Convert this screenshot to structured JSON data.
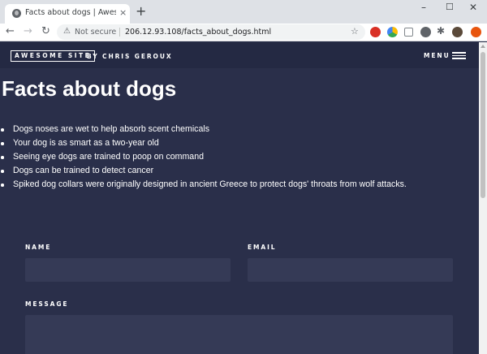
{
  "browser": {
    "tab_title": "Facts about dogs | Awesome Site",
    "tab_close": "×",
    "new_tab": "+",
    "window_minimize": "–",
    "window_maximize": "☐",
    "window_close": "✕",
    "nav_back": "←",
    "nav_forward": "→",
    "nav_reload": "↻",
    "security_icon": "⚠",
    "security_label": "Not secure",
    "url": "206.12.93.108/facts_about_dogs.html",
    "bookmark_icon": "☆",
    "extensions_icon": "✱"
  },
  "site": {
    "brand": "AWESOME SITE",
    "byline": "BY CHRIS GEROUX",
    "menu_label": "MENU"
  },
  "main": {
    "title": "Facts about dogs",
    "facts": [
      "Dogs noses are wet to help absorb scent chemicals",
      "Your dog is as smart as a two-year old",
      "Seeing eye dogs are trained to poop on command",
      "Dogs can be trained to detect cancer",
      "Spiked dog collars were originally designed in ancient Greece to protect dogs' throats from wolf attacks."
    ]
  },
  "form": {
    "name_label": "NAME",
    "name_value": "",
    "email_label": "EMAIL",
    "email_value": "",
    "message_label": "MESSAGE",
    "message_value": ""
  }
}
